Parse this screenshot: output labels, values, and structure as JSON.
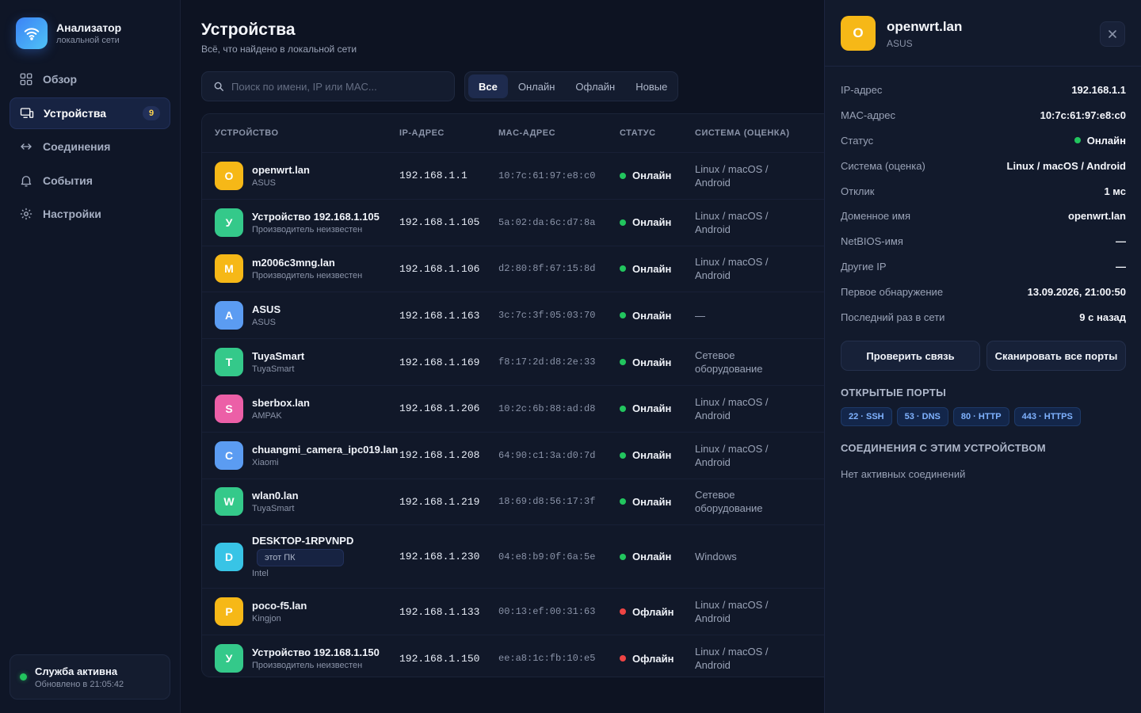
{
  "app": {
    "title": "Анализатор",
    "subtitle": "локальной сети"
  },
  "sidebar": {
    "items": [
      {
        "label": "Обзор",
        "icon": "grid-icon"
      },
      {
        "label": "Устройства",
        "icon": "devices-icon",
        "badge": "9",
        "active": true
      },
      {
        "label": "Соединения",
        "icon": "arrows-icon"
      },
      {
        "label": "События",
        "icon": "bell-icon"
      },
      {
        "label": "Настройки",
        "icon": "gear-icon"
      }
    ],
    "service": {
      "title": "Служба активна",
      "updated": "Обновлено в 21:05:42"
    }
  },
  "page": {
    "title": "Устройства",
    "subtitle": "Всё, что найдено в локальной сети"
  },
  "search": {
    "placeholder": "Поиск по имени, IP или MAC...",
    "value": ""
  },
  "filters": [
    "Все",
    "Онлайн",
    "Офлайн",
    "Новые"
  ],
  "table": {
    "headers": [
      "УСТРОЙСТВО",
      "IP-АДРЕС",
      "MAC-АДРЕС",
      "СТАТУС",
      "СИСТЕМА (ОЦЕНКА)"
    ],
    "rows": [
      {
        "letter": "O",
        "name": "openwrt.lan",
        "vendor": "ASUS",
        "ip": "192.168.1.1",
        "mac": "10:7c:61:97:e8:c0",
        "status": "Онлайн",
        "system": "Linux / macOS / Android",
        "color": "#f6b817"
      },
      {
        "letter": "У",
        "name": "Устройство 192.168.1.105",
        "vendor": "Производитель неизвестен",
        "ip": "192.168.1.105",
        "mac": "5a:02:da:6c:d7:8a",
        "status": "Онлайн",
        "system": "Linux / macOS / Android",
        "color": "#34c98a"
      },
      {
        "letter": "M",
        "name": "m2006c3mng.lan",
        "vendor": "Производитель неизвестен",
        "ip": "192.168.1.106",
        "mac": "d2:80:8f:67:15:8d",
        "status": "Онлайн",
        "system": "Linux / macOS / Android",
        "color": "#f6b817"
      },
      {
        "letter": "A",
        "name": "ASUS",
        "vendor": "ASUS",
        "ip": "192.168.1.163",
        "mac": "3c:7c:3f:05:03:70",
        "status": "Онлайн",
        "system": "—",
        "color": "#5b9cf2"
      },
      {
        "letter": "T",
        "name": "TuyaSmart",
        "vendor": "TuyaSmart",
        "ip": "192.168.1.169",
        "mac": "f8:17:2d:d8:2e:33",
        "status": "Онлайн",
        "system": "Сетевое оборудование",
        "color": "#34c98a"
      },
      {
        "letter": "S",
        "name": "sberbox.lan",
        "vendor": "AMPAK",
        "ip": "192.168.1.206",
        "mac": "10:2c:6b:88:ad:d8",
        "status": "Онлайн",
        "system": "Linux / macOS / Android",
        "color": "#ec5fa7"
      },
      {
        "letter": "C",
        "name": "chuangmi_camera_ipc019.lan",
        "vendor": "Xiaomi",
        "ip": "192.168.1.208",
        "mac": "64:90:c1:3a:d0:7d",
        "status": "Онлайн",
        "system": "Linux / macOS / Android",
        "color": "#5b9cf2"
      },
      {
        "letter": "W",
        "name": "wlan0.lan",
        "vendor": "TuyaSmart",
        "ip": "192.168.1.219",
        "mac": "18:69:d8:56:17:3f",
        "status": "Онлайн",
        "system": "Сетевое оборудование",
        "color": "#34c98a"
      },
      {
        "letter": "D",
        "name": "DESKTOP-1RPVNPD",
        "badge": "этот ПК",
        "vendor": "Intel",
        "ip": "192.168.1.230",
        "mac": "04:e8:b9:0f:6a:5e",
        "status": "Онлайн",
        "system": "Windows",
        "color": "#38c4e6"
      },
      {
        "letter": "P",
        "name": "poco-f5.lan",
        "vendor": "Kingjon",
        "ip": "192.168.1.133",
        "mac": "00:13:ef:00:31:63",
        "status": "Офлайн",
        "system": "Linux / macOS / Android",
        "color": "#f6b817"
      },
      {
        "letter": "У",
        "name": "Устройство 192.168.1.150",
        "vendor": "Производитель неизвестен",
        "ip": "192.168.1.150",
        "mac": "ee:a8:1c:fb:10:e5",
        "status": "Офлайн",
        "system": "Linux / macOS / Android",
        "color": "#34c98a"
      }
    ]
  },
  "colors": {
    "online": "#22c55e",
    "offline": "#ef4444",
    "accent": "#3b82f6"
  },
  "panel": {
    "letter": "O",
    "title": "openwrt.lan",
    "subtitle": "ASUS",
    "props": [
      {
        "k": "IP-адрес",
        "v": "192.168.1.1"
      },
      {
        "k": "MAC-адрес",
        "v": "10:7c:61:97:e8:c0"
      },
      {
        "k": "Статус",
        "v": "Онлайн",
        "dot": true
      },
      {
        "k": "Система (оценка)",
        "v": "Linux / macOS / Android"
      },
      {
        "k": "Отклик",
        "v": "1 мс"
      },
      {
        "k": "Доменное имя",
        "v": "openwrt.lan"
      },
      {
        "k": "NetBIOS-имя",
        "v": "—"
      },
      {
        "k": "Другие IP",
        "v": "—"
      },
      {
        "k": "Первое обнаружение",
        "v": "13.09.2026, 21:00:50"
      },
      {
        "k": "Последний раз в сети",
        "v": "9 с назад"
      }
    ],
    "buttons": {
      "ping": "Проверить связь",
      "scan": "Сканировать все порты"
    },
    "ports_title": "ОТКРЫТЫЕ ПОРТЫ",
    "ports": [
      "22 · SSH",
      "53 · DNS",
      "80 · HTTP",
      "443 · HTTPS"
    ],
    "connections_title": "СОЕДИНЕНИЯ С ЭТИМ УСТРОЙСТВОМ",
    "connections_empty": "Нет активных соединений"
  }
}
